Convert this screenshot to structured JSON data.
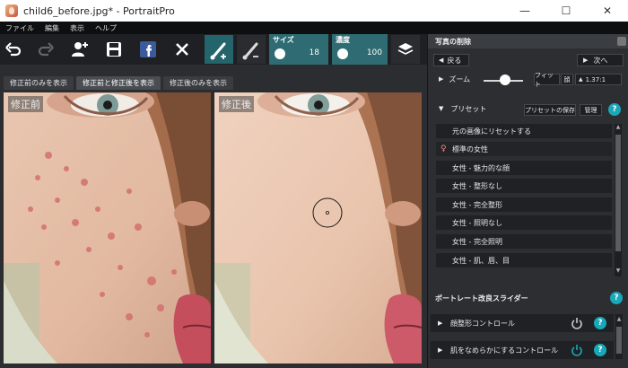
{
  "window": {
    "title": "child6_before.jpg* - PortraitPro"
  },
  "menu": [
    "ファイル",
    "編集",
    "表示",
    "ヘルプ"
  ],
  "toolbar": {
    "size_label": "サイズ",
    "size_value": "18",
    "density_label": "濃度",
    "density_value": "100"
  },
  "tabs": [
    "修正前のみを表示",
    "修正前と修正後を表示",
    "修正後のみを表示"
  ],
  "images": {
    "before_label": "修正前",
    "after_label": "修正後"
  },
  "panel": {
    "title": "写真の削除",
    "back": "戻る",
    "next": "次へ",
    "zoom": "ズーム",
    "fit": "フィット",
    "face": "顔",
    "zoom_value": "1.37:1",
    "presets_title": "プリセット",
    "save_preset": "プリセットの保存",
    "manage": "管理",
    "presets": [
      "元の画像にリセットする",
      "標準の女性",
      "女性 - 魅力的な顔",
      "女性 - 整形なし",
      "女性 - 完全整形",
      "女性 - 照明なし",
      "女性 - 完全照明",
      "女性 - 肌、唇、目"
    ],
    "sliders_title": "ポートレート改良スライダー",
    "slider_items": [
      "顔整形コントロール",
      "肌をなめらかにするコントロール"
    ]
  },
  "colors": {
    "accent": "#19a8b9",
    "tool_active": "#24646b",
    "slider_box": "#2e6b72"
  }
}
